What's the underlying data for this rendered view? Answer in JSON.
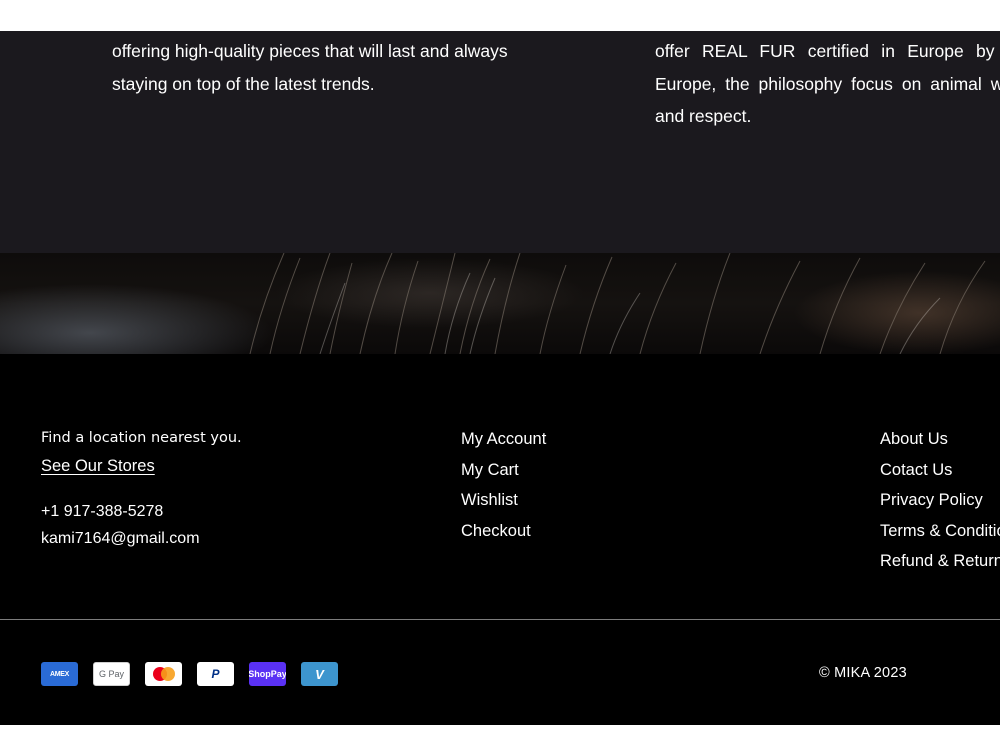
{
  "about": {
    "left_text": "offering high-quality pieces that will last and always staying on top of the latest trends.",
    "right_text": "offer REAL FUR certified in Europe by Saga Furs Europe, the philosophy focus on animal welfare, care and respect."
  },
  "footer": {
    "tagline": "Find a location nearest you.",
    "stores_link": "See Our Stores",
    "phone": "+1 917-388-5278",
    "email": "kami7164@gmail.com",
    "links_col1": [
      "My Account",
      "My Cart",
      "Wishlist",
      "Checkout"
    ],
    "links_col2": [
      "About Us",
      "Cotact Us",
      "Privacy Policy",
      "Terms & Conditions",
      "Refund & Returns"
    ],
    "payments": [
      {
        "name": "American Express",
        "label": "AMEX",
        "icon": "amex-icon"
      },
      {
        "name": "Google Pay",
        "label": "G Pay",
        "icon": "google-pay-icon"
      },
      {
        "name": "Mastercard",
        "label": "",
        "icon": "mastercard-icon"
      },
      {
        "name": "PayPal",
        "label": "P",
        "icon": "paypal-icon"
      },
      {
        "name": "Shop Pay",
        "label": "ShopPay",
        "icon": "shop-pay-icon"
      },
      {
        "name": "Venmo",
        "label": "V",
        "icon": "venmo-icon"
      }
    ],
    "copyright": "© MIKA 2023"
  },
  "colors": {
    "about_bg": "#1b191e",
    "footer_bg": "#000000",
    "text": "#ffffff",
    "divider": "#7d7d7d"
  }
}
